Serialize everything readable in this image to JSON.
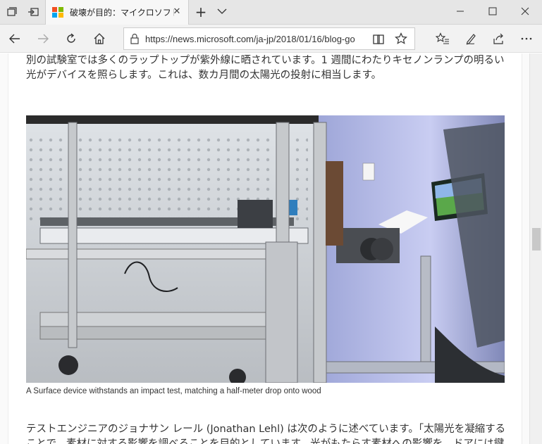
{
  "browser": {
    "tab": {
      "title": "破壊が目的：マイクロソフト",
      "favicon_colors": [
        "#f25022",
        "#7fba00",
        "#00a4ef",
        "#ffb900"
      ]
    },
    "address": {
      "url": "https://news.microsoft.com/ja-jp/2018/01/16/blog-go"
    },
    "icons": {
      "tab_list": "tab-list-icon",
      "set_aside": "set-aside-icon",
      "new_tab": "plus-icon",
      "tab_dropdown": "chevron-down-icon",
      "minimize": "minimize-icon",
      "maximize": "maximize-icon",
      "close": "close-icon",
      "back": "back-arrow-icon",
      "forward": "forward-arrow-icon",
      "refresh": "refresh-icon",
      "home": "home-icon",
      "lock": "lock-icon",
      "reading_view": "reading-view-icon",
      "favorite": "star-icon",
      "favorites_hub": "favorites-hub-icon",
      "notes": "pen-icon",
      "share": "share-icon",
      "more": "more-icon"
    }
  },
  "article": {
    "paragraph_before": "別の試験室では多くのラップトップが紫外線に晒されています。1 週間にわたりキセノンランプの明るい光がデバイスを照らします。これは、数カ月間の太陽光の投射に相当します。",
    "image_caption": "A Surface device withstands an impact test, matching a half-meter drop onto wood",
    "paragraph_after": "テストエンジニアのジョナサン レール (Jonathan Lehl) は次のように述べています。「太陽光を凝縮することで、素材に対する影響を調べることを目的としています。光がもたらす素材への影響を、ドアには鍵"
  }
}
